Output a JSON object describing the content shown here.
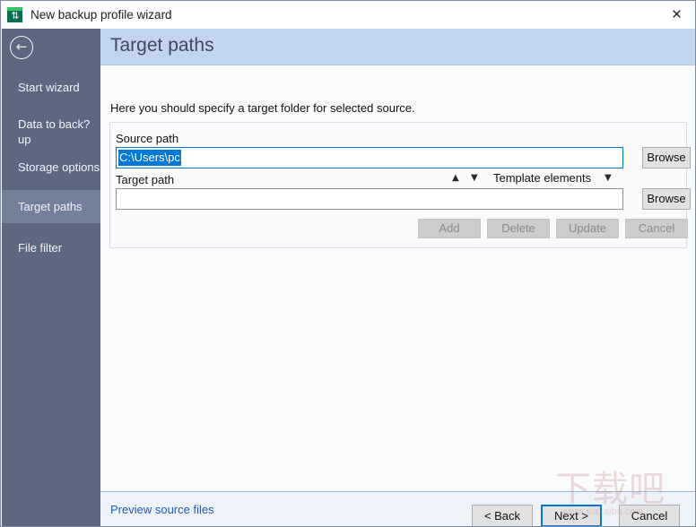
{
  "window": {
    "title": "New backup profile wizard",
    "app_icon": "backup-arrows-icon",
    "close_label": "✕"
  },
  "sidebar": {
    "back_icon": "←",
    "items": [
      {
        "label": "Start wizard",
        "selected": false
      },
      {
        "label": "Data to back?up",
        "selected": false
      },
      {
        "label": "Storage options",
        "selected": false
      },
      {
        "label": "Target paths",
        "selected": true
      },
      {
        "label": "File filter",
        "selected": false
      }
    ]
  },
  "header": {
    "title": "Target paths",
    "subtitle": "Here you should specify a target folder for selected source."
  },
  "form": {
    "source_label": "Source path",
    "source_value": "C:\\Users\\pc",
    "source_browse_label": "Browse",
    "target_label": "Target path",
    "target_value": "",
    "target_placeholder": "",
    "target_browse_label": "Browse",
    "spin_up": "▲",
    "spin_down": "▼",
    "template_label": "Template elements",
    "template_caret": "▼",
    "actions": [
      {
        "label": "Add",
        "enabled": false
      },
      {
        "label": "Delete",
        "enabled": false
      },
      {
        "label": "Update",
        "enabled": false
      },
      {
        "label": "Cancel",
        "enabled": false
      }
    ]
  },
  "footer": {
    "preview_link": "Preview source files",
    "back_label": "< Back",
    "next_label": "Next >",
    "cancel_label": "Cancel"
  },
  "watermark": {
    "text_cn": "下载吧",
    "url": "www.xiazaiba.com"
  },
  "colors": {
    "sidebar": "#5b6880",
    "sidebar_selected": "#73809a",
    "banner": "#c2d4ef",
    "accent_focus": "#0078d7",
    "link": "#1f5bbf",
    "selection": "#0078d7"
  }
}
